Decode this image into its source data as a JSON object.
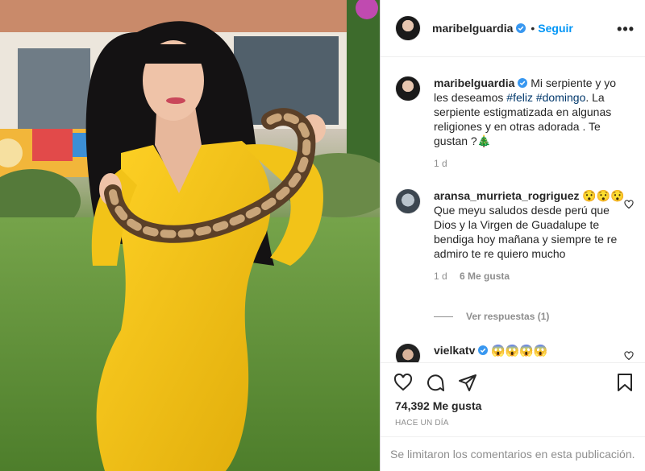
{
  "post": {
    "username": "maribelguardia",
    "follow_label": "Seguir",
    "dot": "•",
    "more_label": "•••",
    "caption_text": "Mi serpiente y yo les deseamos",
    "hashtag_1": "#feliz",
    "hashtag_2": "#domingo",
    "caption_rest": ". La serpiente estigmatizada en algunas religiones y en otras adorada . Te gustan ?🎄",
    "caption_time": "1 d"
  },
  "comments": [
    {
      "username": "aransa_murrieta_rogriguez",
      "text": "😯😯😯Que meyu saludos desde perú que Dios y la Virgen de Guadalupe te bendiga hoy mañana y siempre te re admiro te re quiero mucho",
      "time": "1 d",
      "likes": "6 Me gusta",
      "replies_label": "Ver respuestas (1)"
    },
    {
      "username": "vielkatv",
      "text": "😱😱😱😱"
    }
  ],
  "footer": {
    "likes": "74,392 Me gusta",
    "date": "HACE UN DÍA",
    "limited_notice": "Se limitaron los comentarios en esta publicación."
  },
  "icons": {
    "like": "heart-icon",
    "comment": "comment-icon",
    "share": "paper-plane-icon",
    "save": "bookmark-icon",
    "verified": "verified-badge-icon",
    "options": "more-options-icon"
  },
  "colors": {
    "link": "#0095f6",
    "hashtag": "#00376b",
    "muted": "#8e8e8e",
    "dress": "#f2c318"
  }
}
